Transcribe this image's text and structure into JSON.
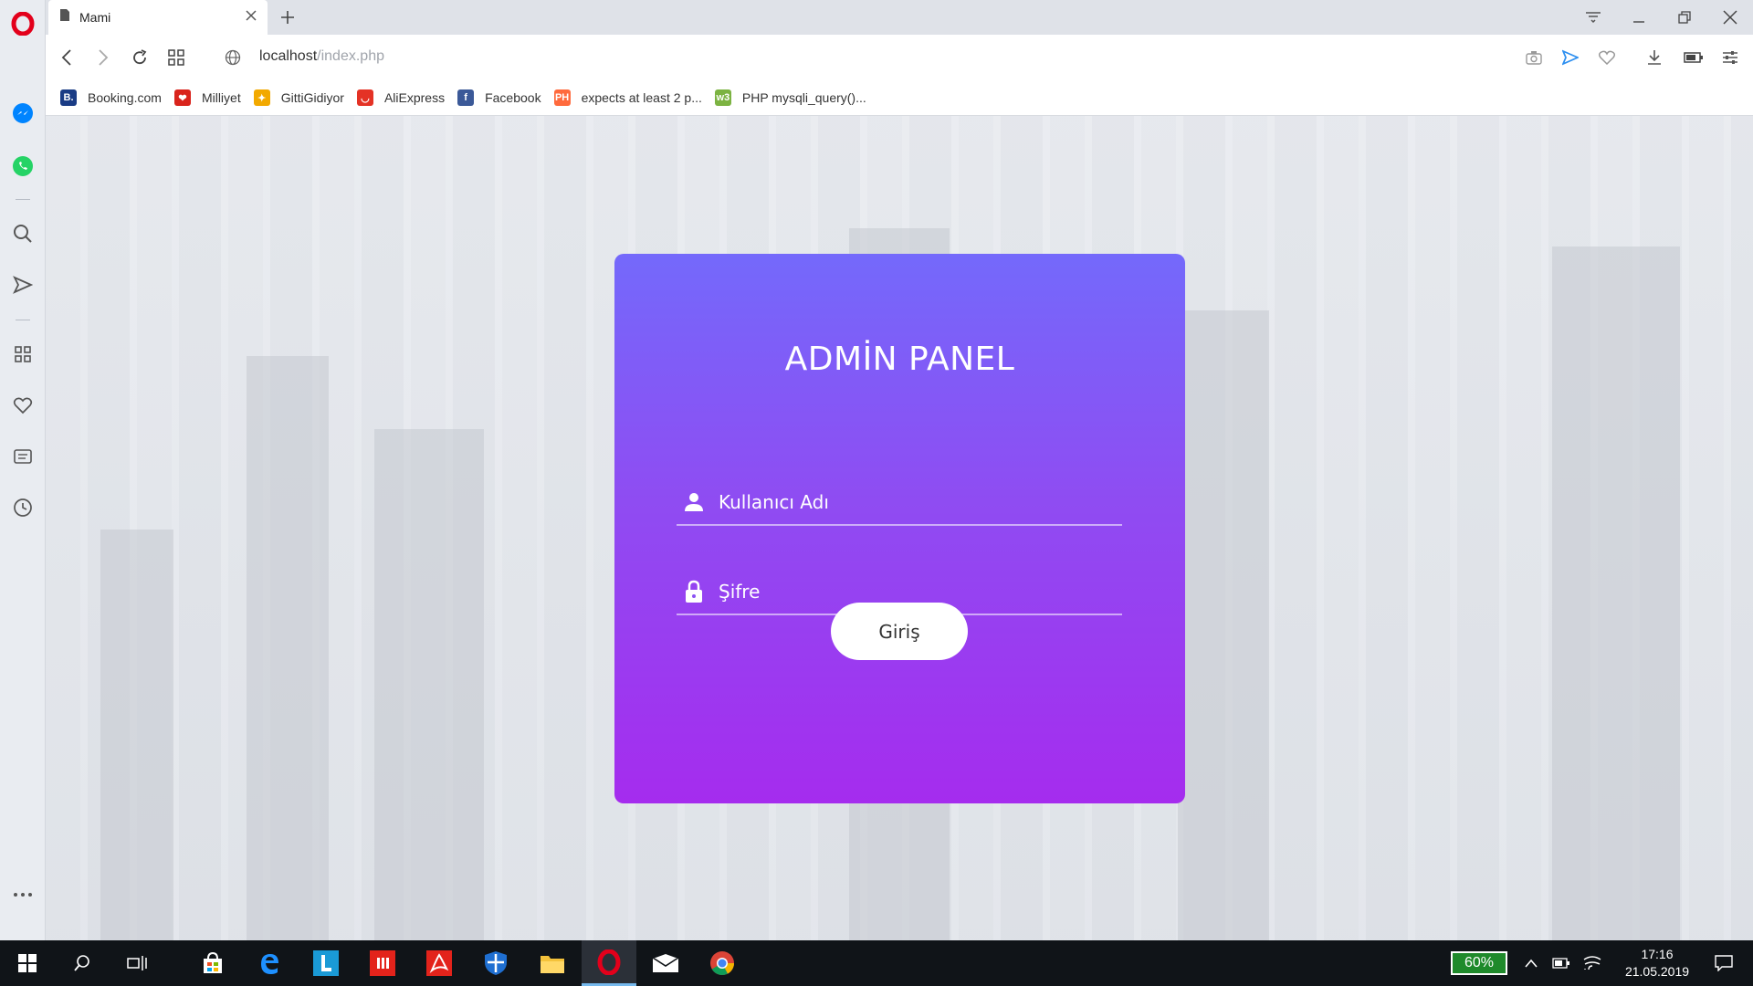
{
  "browser": {
    "tab_title": "Mami",
    "url_host": "localhost",
    "url_path": "/index.php"
  },
  "bookmarks": [
    {
      "label": "Booking.com",
      "icon": "booking-icon",
      "color": "#1a3c85",
      "glyph": "B."
    },
    {
      "label": "Milliyet",
      "icon": "milliyet-icon",
      "color": "#d9241c",
      "glyph": "❤"
    },
    {
      "label": "GittiGidiyor",
      "icon": "gittigidiyor-icon",
      "color": "#f2a900",
      "glyph": "✦"
    },
    {
      "label": "AliExpress",
      "icon": "aliexpress-icon",
      "color": "#e43225",
      "glyph": "◡"
    },
    {
      "label": "Facebook",
      "icon": "facebook-icon",
      "color": "#3b5998",
      "glyph": "f"
    },
    {
      "label": "expects at least 2 p...",
      "icon": "php-error-icon",
      "color": "#ff6a3d",
      "glyph": "PH"
    },
    {
      "label": "PHP mysqli_query()...",
      "icon": "php-icon",
      "color": "#7cb342",
      "glyph": "w3"
    }
  ],
  "login": {
    "title": "ADMİN PANEL",
    "username_placeholder": "Kullanıcı Adı",
    "password_placeholder": "Şifre",
    "submit_label": "Giriş"
  },
  "taskbar": {
    "battery": "60%",
    "time": "17:16",
    "date": "21.05.2019"
  },
  "colors": {
    "card_top": "#7469fb",
    "card_bottom": "#a52cee",
    "opera_red": "#e3001b"
  }
}
